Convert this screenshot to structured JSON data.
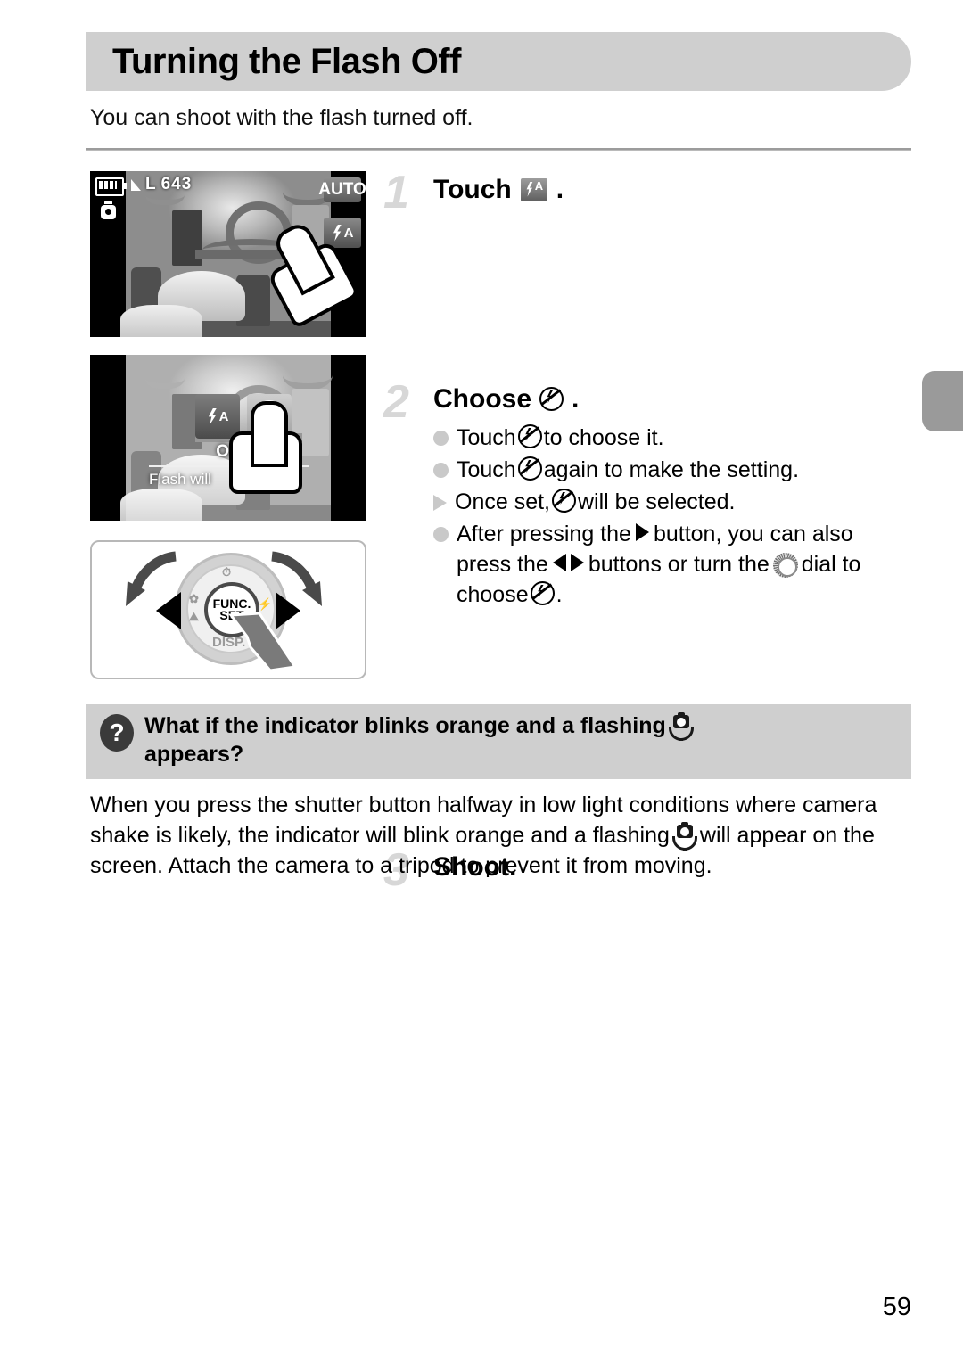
{
  "page": {
    "title": "Turning the Flash Off",
    "intro": "You can shoot with the flash turned off.",
    "number": "59"
  },
  "figures": {
    "lcd1": {
      "name": "shooting-screen",
      "battery_icon": "battery-icon",
      "still_image_icon": "still-image-icon",
      "quality_icon": "image-quality-icon",
      "quality_label": "L",
      "shots_remaining": "643",
      "mode_badge": "AUTO",
      "flash_button_icon": "flash-auto-icon",
      "flash_button_label": "A",
      "hand_icon": "touch-hand-icon"
    },
    "lcd2": {
      "name": "flash-menu-screen",
      "option_auto_icon": "flash-auto-icon",
      "option_auto_label": "A",
      "option_off_icon": "flash-off-icon",
      "selected_label": "Off",
      "description": "Flash will",
      "hand_icon": "touch-hand-icon"
    },
    "dial": {
      "name": "control-dial-diagram",
      "center_line1": "FUNC.",
      "center_line2": "SET",
      "mark_top": "self-timer-icon",
      "mark_left_upper": "macro-icon",
      "mark_left_lower": "landscape-icon",
      "mark_right": "flash-icon",
      "mark_bottom": "DISP.",
      "arrow_left": "left-button",
      "arrow_right": "right-button",
      "rotate_left": "rotate-left-arrow",
      "rotate_right": "rotate-right-arrow",
      "press_arrow": "press-pointer"
    }
  },
  "steps": [
    {
      "number": "1",
      "head_pre": "Touch",
      "head_icon": "flash-auto-icon",
      "head_post": ".",
      "bullets": []
    },
    {
      "number": "2",
      "head_pre": "Choose",
      "head_icon": "flash-off-icon",
      "head_post": ".",
      "bullets": [
        {
          "marker": "dot",
          "pre": "Touch",
          "icon": "flash-off-icon",
          "post": "to choose it."
        },
        {
          "marker": "dot",
          "pre": "Touch",
          "icon": "flash-off-icon",
          "post": "again to make the setting."
        },
        {
          "marker": "triangle",
          "pre": "Once set,",
          "icon": "flash-off-icon",
          "post": "will be selected."
        },
        {
          "marker": "dot",
          "pre": "After pressing the",
          "icon": "right-button-icon",
          "mid1": "button, you can also press the",
          "icon2": "left-right-buttons-icon",
          "mid2": "buttons or turn the",
          "icon3": "control-dial-icon",
          "mid3": "dial to choose",
          "icon4": "flash-off-icon",
          "post": "."
        }
      ]
    },
    {
      "number": "3",
      "head_pre": "Shoot.",
      "head_icon": "",
      "head_post": "",
      "bullets": []
    }
  ],
  "tip": {
    "icon": "question-mark-icon",
    "title_pre": "What if the indicator blinks orange and a flashing",
    "title_icon": "camera-shake-icon",
    "title_post": "appears?",
    "body_pre": "When you press the shutter button halfway in low light conditions where camera shake is likely, the indicator will blink orange and a flashing",
    "body_icon": "camera-shake-icon",
    "body_post": "will appear on the screen. Attach the camera to a tripod to prevent it from moving."
  },
  "colors": {
    "banner": "#cfcfcf",
    "step_number": "#d7d7d7",
    "bullet": "#c9c9c9",
    "tab": "#9a9a9a"
  }
}
